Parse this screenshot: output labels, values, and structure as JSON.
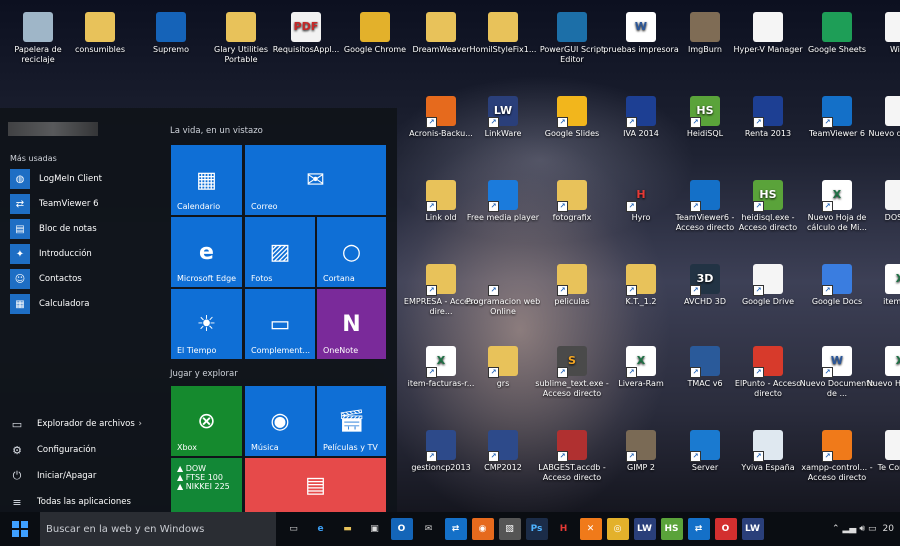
{
  "desktop": {
    "icons": [
      {
        "label": "Papelera de reciclaje",
        "icon": "recycle-bin-icon"
      },
      {
        "label": "consumibles",
        "icon": "folder-icon"
      },
      {
        "label": "Supremo",
        "icon": "supremo-icon"
      },
      {
        "label": "Glary Utilities Portable",
        "icon": "folder-icon"
      },
      {
        "label": "RequisitosAppl...",
        "icon": "pdf-icon",
        "tag": "PDF"
      },
      {
        "label": "Google Chrome",
        "icon": "chrome-icon"
      },
      {
        "label": "DreamWeaver",
        "icon": "folder-icon"
      },
      {
        "label": "HomilStyleFix1...",
        "icon": "folder-icon"
      },
      {
        "label": "PowerGUI Script Editor",
        "icon": "powergui-icon"
      },
      {
        "label": "pruebas impresora",
        "icon": "word-doc-icon",
        "tag": "W"
      },
      {
        "label": "ImgBurn",
        "icon": "imgburn-icon"
      },
      {
        "label": "Hyper-V Manager",
        "icon": "file-icon"
      },
      {
        "label": "Google Sheets",
        "icon": "google-sheets-icon"
      },
      {
        "label": "Wind",
        "icon": "file-icon"
      },
      {
        "label": "Acronis-Backu...",
        "icon": "firefox-icon"
      },
      {
        "label": "LinkWare",
        "icon": "linkware-icon",
        "tag": "LW"
      },
      {
        "label": "Google Slides",
        "icon": "google-slides-icon"
      },
      {
        "label": "IVA 2014",
        "icon": "aeat-icon"
      },
      {
        "label": "HeidiSQL",
        "icon": "heidisql-icon",
        "tag": "HS"
      },
      {
        "label": "Renta 2013",
        "icon": "aeat-icon"
      },
      {
        "label": "TeamViewer 6",
        "icon": "teamviewer-icon"
      },
      {
        "label": "Nuevo docum...",
        "icon": "file-icon"
      },
      {
        "label": "Link old",
        "icon": "folder-icon"
      },
      {
        "label": "Free media player",
        "icon": "media-player-icon"
      },
      {
        "label": "fotografix",
        "icon": "folder-icon"
      },
      {
        "label": "Hyro",
        "icon": "hyro-icon",
        "tag": "H"
      },
      {
        "label": "TeamViewer6 - Acceso directo",
        "icon": "teamviewer-icon"
      },
      {
        "label": "heidisql.exe - Acceso directo",
        "icon": "heidisql-icon",
        "tag": "HS"
      },
      {
        "label": "Nuevo Hoja de cálculo de Mi...",
        "icon": "excel-icon",
        "tag": "X"
      },
      {
        "label": "DOSB...",
        "icon": "file-icon"
      },
      {
        "label": "EMPRESA - Acceso dire...",
        "icon": "folder-icon"
      },
      {
        "label": "Programacion web Online",
        "icon": "no-entry-icon"
      },
      {
        "label": "peliculas",
        "icon": "folder-icon"
      },
      {
        "label": "K.T._1.2",
        "icon": "folder-icon"
      },
      {
        "label": "AVCHD 3D",
        "icon": "avchd-icon",
        "tag": "3D"
      },
      {
        "label": "Google Drive",
        "icon": "file-icon"
      },
      {
        "label": "Google Docs",
        "icon": "google-docs-icon"
      },
      {
        "label": "item-fi...",
        "icon": "excel-icon",
        "tag": "X"
      },
      {
        "label": "item-facturas-r...",
        "icon": "excel-icon",
        "tag": "X"
      },
      {
        "label": "grs",
        "icon": "folder-icon"
      },
      {
        "label": "sublime_text.exe - Acceso directo",
        "icon": "sublime-icon",
        "tag": "S"
      },
      {
        "label": "Livera-Ram",
        "icon": "excel-icon",
        "tag": "X"
      },
      {
        "label": "TMAC v6",
        "icon": "tmac-icon"
      },
      {
        "label": "ElPunto - Acceso directo",
        "icon": "elpunto-icon"
      },
      {
        "label": "Nuevo Documento de ...",
        "icon": "word-doc-icon",
        "tag": "W"
      },
      {
        "label": "Nuevo Hoja de...",
        "icon": "excel-icon",
        "tag": "X"
      },
      {
        "label": "gestioncp2013",
        "icon": "gestion-icon"
      },
      {
        "label": "CMP2012",
        "icon": "gestion-icon"
      },
      {
        "label": "LABGEST.accdb - Acceso directo",
        "icon": "tools-icon"
      },
      {
        "label": "GIMP 2",
        "icon": "gimp-icon"
      },
      {
        "label": "Server",
        "icon": "server-icon"
      },
      {
        "label": "Yviva España",
        "icon": "disc-icon"
      },
      {
        "label": "xampp-control... - Acceso directo",
        "icon": "xampp-icon"
      },
      {
        "label": "Te Comm...",
        "icon": "file-icon"
      }
    ]
  },
  "start_menu": {
    "most_used_label": "Más usadas",
    "most_used": [
      {
        "label": "LogMeIn Client",
        "icon": "logmein-icon"
      },
      {
        "label": "TeamViewer 6",
        "icon": "teamviewer-icon"
      },
      {
        "label": "Bloc de notas",
        "icon": "notepad-icon"
      },
      {
        "label": "Introducción",
        "icon": "lightbulb-icon"
      },
      {
        "label": "Contactos",
        "icon": "contacts-icon"
      },
      {
        "label": "Calculadora",
        "icon": "calculator-icon"
      }
    ],
    "bottom": [
      {
        "label": "Explorador de archivos",
        "icon": "file-explorer-icon"
      },
      {
        "label": "Configuración",
        "icon": "gear-icon"
      },
      {
        "label": "Iniciar/Apagar",
        "icon": "power-icon"
      },
      {
        "label": "Todas las aplicaciones",
        "icon": "all-apps-icon"
      }
    ],
    "group1_title": "La vida, en un vistazo",
    "group2_title": "Jugar y explorar",
    "tiles": {
      "calendario": "Calendario",
      "correo": "Correo",
      "edge": "Microsoft Edge",
      "fotos": "Fotos",
      "cortana": "Cortana",
      "tiempo": "El Tiempo",
      "complement": "Complement...",
      "onenote": "OneNote",
      "xbox": "Xbox",
      "musica": "Música",
      "peliculas": "Películas y TV"
    },
    "markets": [
      "▲ DOW",
      "▲ FTSE 100",
      "▲ NIKKEI 225"
    ]
  },
  "taskbar": {
    "search_placeholder": "Buscar en la web y en Windows",
    "apps": [
      "task-view-icon",
      "edge-icon",
      "file-explorer-icon",
      "store-icon",
      "outlook-icon",
      "mail-icon",
      "teamviewer-icon",
      "firefox-icon",
      "paint-icon",
      "photoshop-icon",
      "hyro-icon",
      "xampp-icon",
      "chrome-icon",
      "linkware-icon",
      "heidisql-icon",
      "teamviewer-icon",
      "opera-icon",
      "linkware-icon"
    ],
    "clock": "20"
  },
  "colors": {
    "tile_blue": "#0f6fd6",
    "onenote": "#7a2a9a",
    "xbox": "#158a2e",
    "money": "#128736",
    "news": "#e64a4a"
  }
}
